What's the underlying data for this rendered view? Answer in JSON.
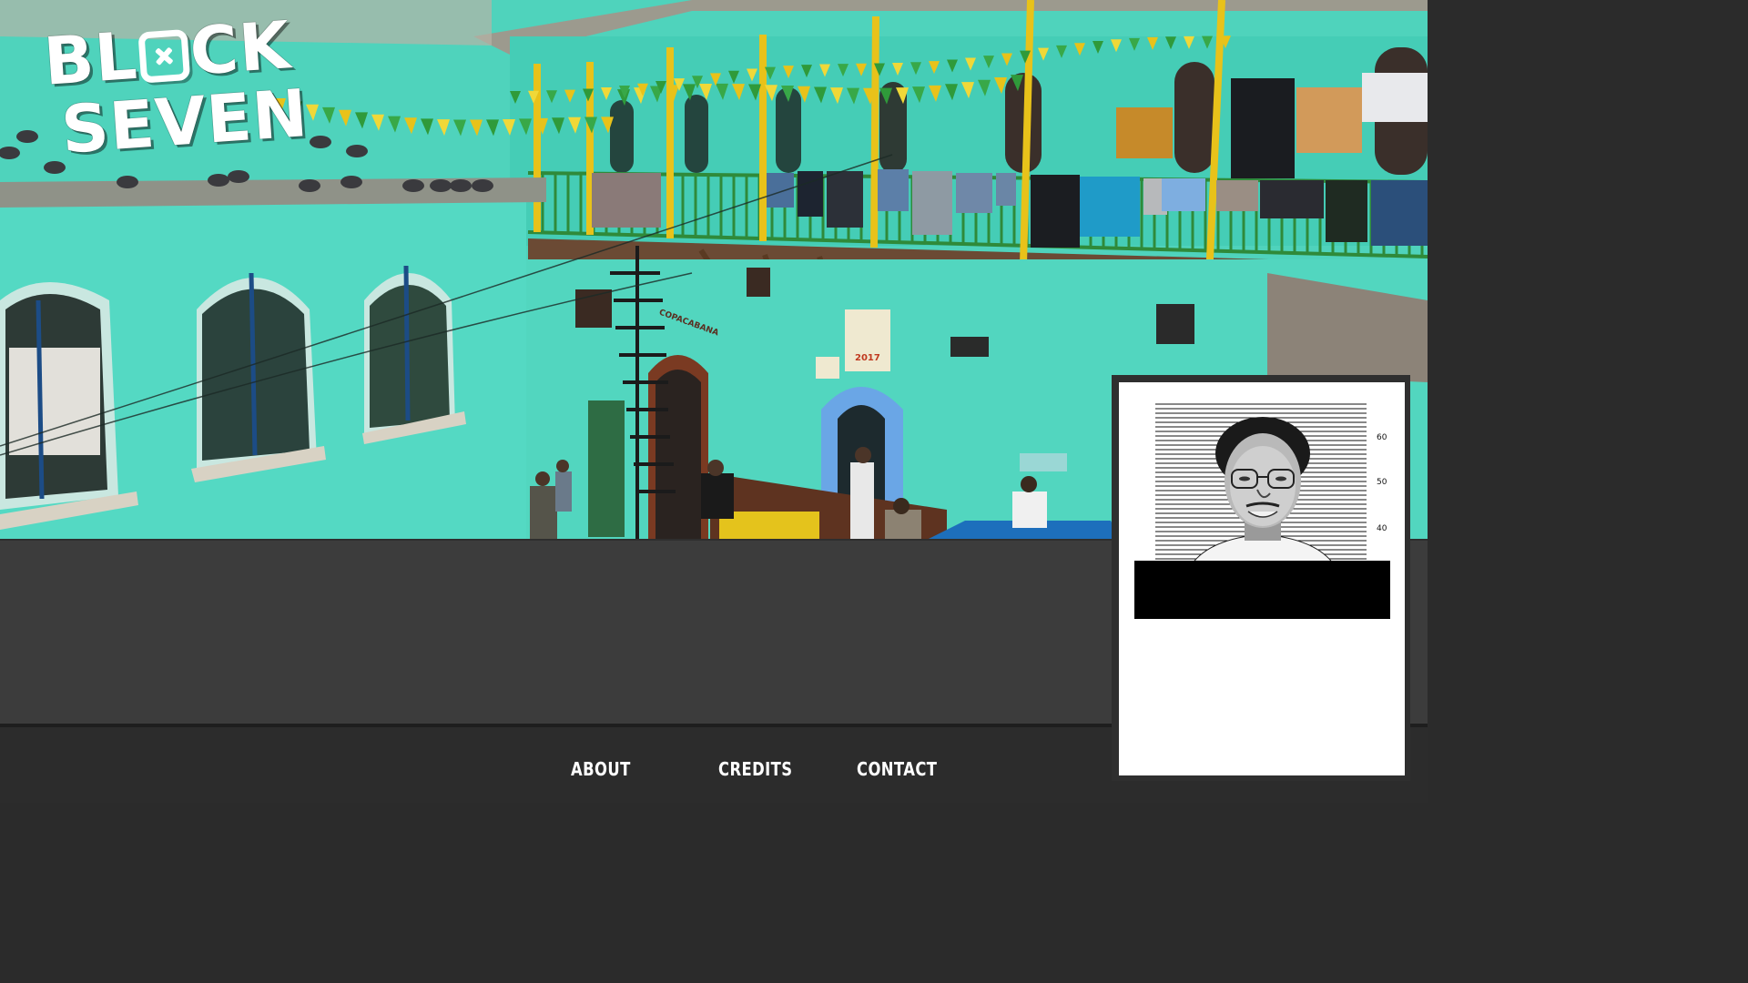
{
  "logo": {
    "line1_prefix": "BL",
    "line1_suffix": "CK",
    "line2": "SEVEN"
  },
  "nav": {
    "items": [
      {
        "label": "ABOUT"
      },
      {
        "label": "CREDITS"
      },
      {
        "label": "CONTACT"
      }
    ]
  },
  "hero_signs": {
    "left_sign": "COPACABANA",
    "center_sign": "2017"
  },
  "mugshot": {
    "height_marks": [
      "60",
      "50",
      "40"
    ]
  },
  "colors": {
    "wall_turquoise": "#4fd3bc",
    "panel_dark": "#3c3c3c",
    "footer_dark": "#2c2c2c",
    "nav_text": "#ffffff",
    "railing_yellow": "#e8c21a",
    "railing_green": "#2f8a3a"
  }
}
